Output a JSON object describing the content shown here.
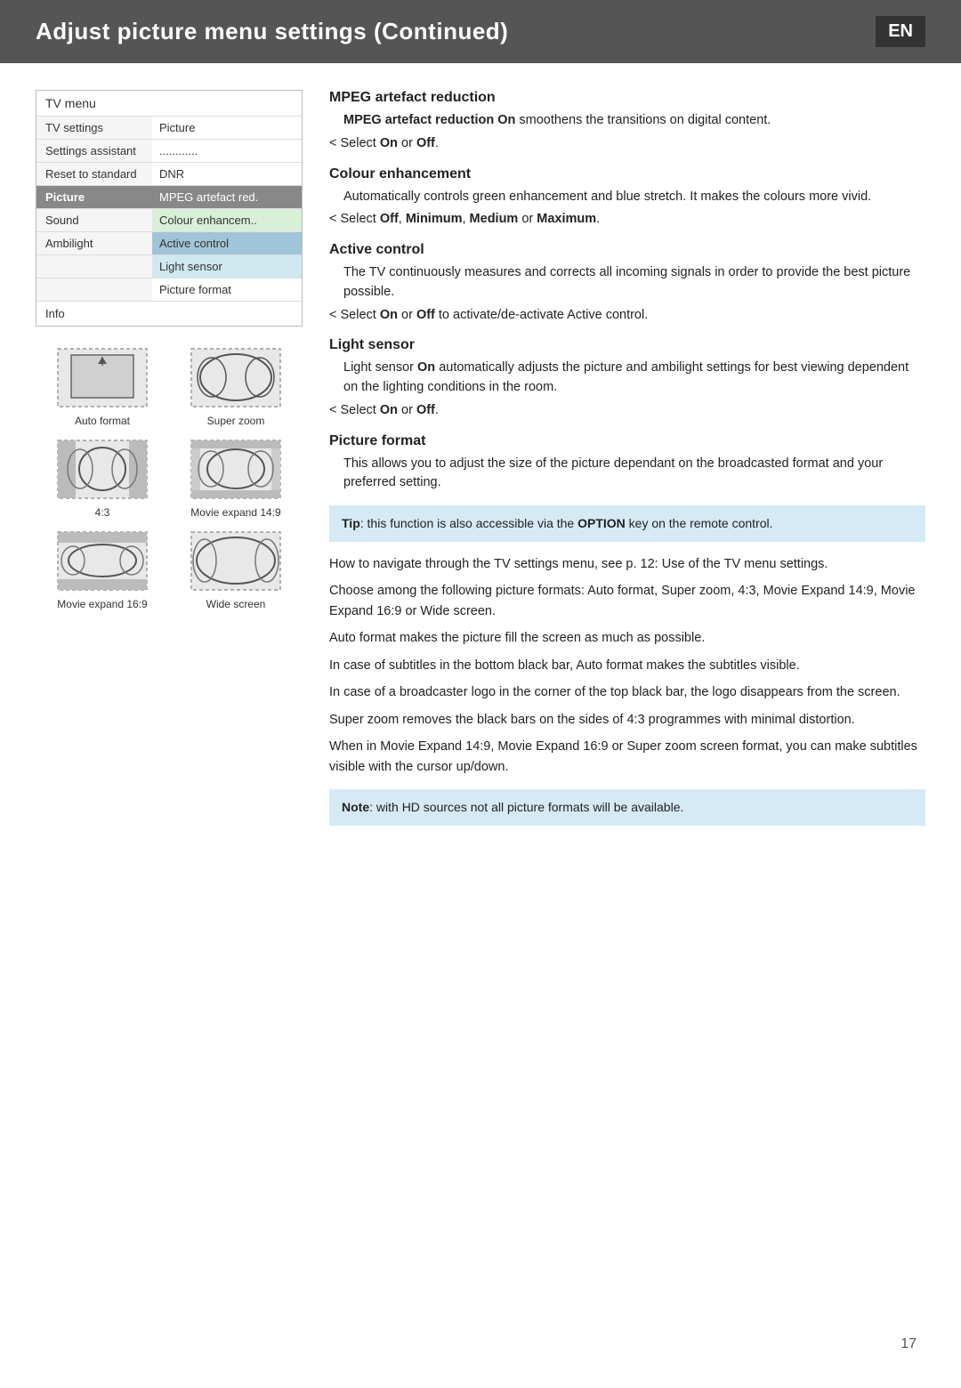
{
  "header": {
    "title": "Adjust picture menu settings  (Continued)",
    "lang": "EN"
  },
  "menu": {
    "header": "TV menu",
    "rows": [
      {
        "left": "TV settings",
        "right": "Picture",
        "style": ""
      },
      {
        "left": "Settings assistant",
        "right": "............",
        "style": ""
      },
      {
        "left": "Reset to standard",
        "right": "DNR",
        "style": ""
      },
      {
        "left": "Picture",
        "right": "MPEG artefact red.",
        "style": "highlighted"
      },
      {
        "left": "Sound",
        "right": "Colour enhancem..",
        "style": ""
      },
      {
        "left": "Ambilight",
        "right": "Active control",
        "style": "active-control"
      },
      {
        "left": "",
        "right": "Light sensor",
        "style": "light-sensor"
      },
      {
        "left": "",
        "right": "Picture format",
        "style": ""
      }
    ],
    "info": "Info"
  },
  "sections": {
    "mpeg": {
      "title": "MPEG artefact reduction",
      "body": "MPEG artefact reduction On smoothens the transitions on digital content.",
      "select": "Select On or Off."
    },
    "colour": {
      "title": "Colour enhancement",
      "body": "Automatically controls green enhancement and blue stretch. It makes the colours more vivid.",
      "select": "Select Off, Minimum, Medium or Maximum."
    },
    "active": {
      "title": "Active control",
      "body": "The TV continuously measures and corrects all incoming signals in order to provide the best picture possible.",
      "select": "Select On or Off to activate/de-activate Active control."
    },
    "light": {
      "title": "Light sensor",
      "body": "Light sensor On automatically adjusts the picture and ambilight settings for best viewing dependent on the lighting conditions in the room.",
      "select": "Select On or Off."
    },
    "picture": {
      "title": "Picture format",
      "body": "This allows you to adjust the size of the picture dependant on the broadcasted format and your preferred setting."
    }
  },
  "tip": {
    "label": "Tip",
    "text": ": this function is also accessible via the OPTION key on the remote control."
  },
  "paragraphs": [
    "How to navigate through the TV settings menu, see p. 12: Use of the TV menu settings.",
    "Choose among the following picture formats: Auto format, Super zoom, 4:3, Movie Expand 14:9, Movie Expand 16:9 or Wide screen.",
    "Auto format makes the picture fill the screen as much as possible.",
    "In case of subtitles in the bottom black bar, Auto format makes the subtitles visible.",
    "In case of a broadcaster logo in the corner of the top black bar, the logo disappears from the screen.",
    "Super zoom removes the black bars on the sides of 4:3 programmes with minimal distortion.",
    "When in Movie Expand 14:9, Movie Expand 16:9 or Super zoom screen format, you can make subtitles visible with the cursor up/down."
  ],
  "note": {
    "label": "Note",
    "text": ": with HD sources not all picture formats will be available."
  },
  "diagrams": {
    "items": [
      {
        "id": "auto-format",
        "label": "Auto format"
      },
      {
        "id": "super-zoom",
        "label": "Super zoom"
      },
      {
        "id": "ratio-43",
        "label": "4:3"
      },
      {
        "id": "movie-149",
        "label": "Movie expand 14:9"
      },
      {
        "id": "movie-169",
        "label": "Movie expand 16:9"
      },
      {
        "id": "wide-screen",
        "label": "Wide screen"
      }
    ]
  },
  "footer": {
    "page": "17"
  }
}
